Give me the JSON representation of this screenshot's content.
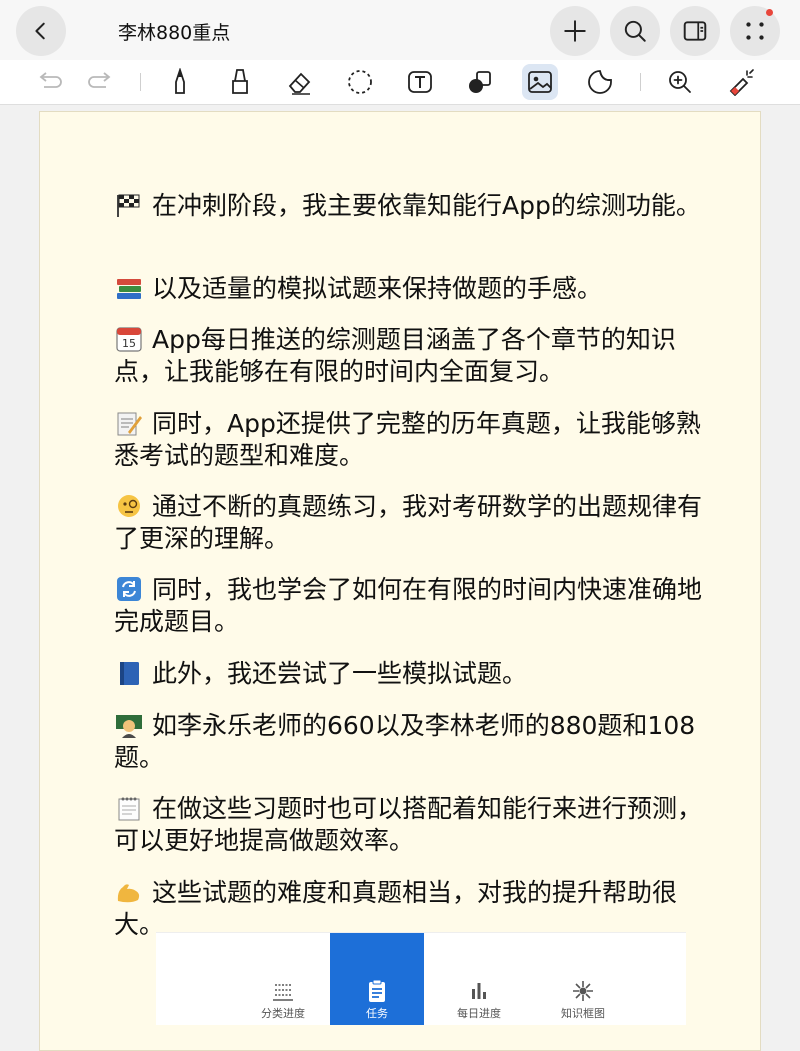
{
  "header": {
    "title": "李林880重点",
    "icons": [
      "back-icon",
      "plus-icon",
      "search-icon",
      "sidebar-toggle-icon",
      "more-icon"
    ]
  },
  "toolbar": {
    "tools": [
      "undo-icon",
      "redo-icon",
      "pen-icon",
      "highlighter-icon",
      "eraser-icon",
      "lasso-icon",
      "text-icon",
      "shapes-icon",
      "image-icon",
      "sticker-icon",
      "zoom-icon",
      "laser-pointer-icon"
    ],
    "active_tool": "image-icon",
    "active_color": "#dce6f3"
  },
  "note": {
    "paragraphs": [
      {
        "emoji": "chequered-flag-icon",
        "text": "在冲刺阶段，我主要依靠知能行App的综测功能。"
      },
      {
        "emoji": "books-icon",
        "text": "以及适量的模拟试题来保持做题的手感。"
      },
      {
        "emoji": "calendar-icon",
        "text": "App每日推送的综测题目涵盖了各个章节的知识点，让我能够在有限的时间内全面复习。"
      },
      {
        "emoji": "memo-icon",
        "text": "同时，App还提供了完整的历年真题，让我能够熟悉考试的题型和难度。"
      },
      {
        "emoji": "monocle-face-icon",
        "text": "通过不断的真题练习，我对考研数学的出题规律有了更深的理解。"
      },
      {
        "emoji": "refresh-icon",
        "text": "同时，我也学会了如何在有限的时间内快速准确地完成题目。"
      },
      {
        "emoji": "blue-book-icon",
        "text": "此外，我还尝试了一些模拟试题。"
      },
      {
        "emoji": "teacher-icon",
        "text": "如李永乐老师的660以及李林老师的880题和108题。"
      },
      {
        "emoji": "spiral-notepad-icon",
        "text": "在做这些习题时也可以搭配着知能行来进行预测，可以更好地提高做题效率。"
      },
      {
        "emoji": "flexed-biceps-icon",
        "text": "这些试题的难度和真题相当，对我的提升帮助很大。"
      }
    ]
  },
  "embedded_app": {
    "tabs": [
      {
        "label": "分类进度",
        "icon": "list-icon"
      },
      {
        "label": "任务",
        "icon": "clipboard-icon",
        "active": true
      },
      {
        "label": "每日进度",
        "icon": "bar-chart-icon"
      },
      {
        "label": "知识框图",
        "icon": "mindmap-icon"
      }
    ],
    "active_color": "#1d6fd8"
  }
}
